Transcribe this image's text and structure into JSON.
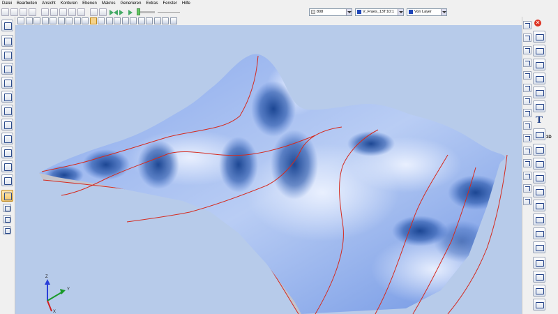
{
  "menu": [
    "Datei",
    "Bearbeiten",
    "Ansicht",
    "Konturen",
    "Ebenen",
    "Makros",
    "Generieren",
    "Extras",
    "Fenster",
    "Hilfe"
  ],
  "toolbar": {
    "layer_number": "808",
    "tool_name": "V_Fraes_13T:10:1",
    "layer_mode": "Von Layer"
  },
  "colors": {
    "viewport_bg": "#b7cbea",
    "surface_light": "#e4ecfc",
    "surface_mid": "#6d93e3",
    "surface_dark": "#15408e",
    "contour_lines": "#d52a1e",
    "side_wall": "#bcbdc8",
    "tool_color_swatch": "#1f46b8"
  },
  "icons": {
    "left_toolbar": [
      "contour-icon",
      "circle-icon",
      "layer-icon",
      "import-icon",
      "milling-icon",
      "lathe-icon",
      "nesting-icon",
      "drilling-icon",
      "rectangle-icon",
      "document-icon",
      "help-icon",
      "layers-icon",
      "hammer-icon",
      "tool-icon",
      "pen-icon",
      "machine-icon"
    ],
    "right_toolbar": [
      "close-icon",
      "circle-arc-icon",
      "curve-icon",
      "spline-icon",
      "text-icon",
      "3d-icon"
    ]
  },
  "labels": {
    "text_tool": "T",
    "three_d": "3D",
    "close_glyph": "✕"
  },
  "axis_labels": {
    "z": "Z",
    "y": "Y",
    "x": "X"
  }
}
